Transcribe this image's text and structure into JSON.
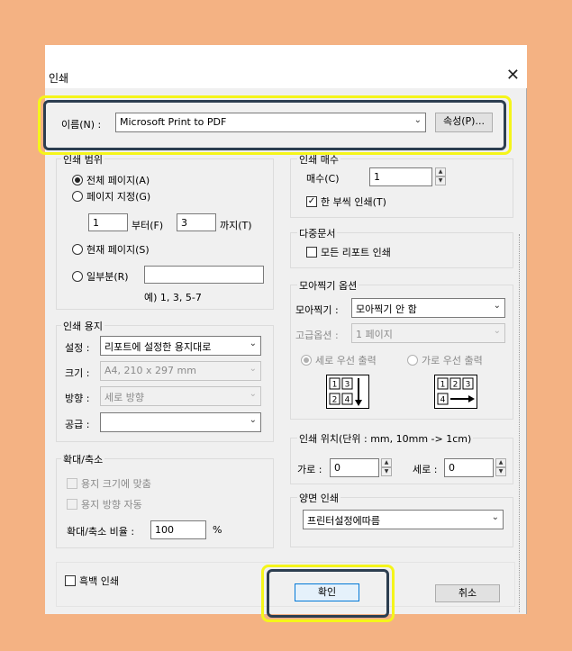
{
  "dialog": {
    "title": "인쇄",
    "close_glyph": "✕"
  },
  "printer": {
    "name_label": "이름(N) :",
    "selected": "Microsoft Print to PDF",
    "properties_button": "속성(P)..."
  },
  "range": {
    "group_label": "인쇄 범위",
    "all_pages": "전체 페이지(A)",
    "page_select": "페이지 지정(G)",
    "from_value": "1",
    "from_label": "부터(F)",
    "to_value": "3",
    "to_label": "까지(T)",
    "current_page": "현재 페이지(S)",
    "partial": "일부분(R)",
    "partial_value": "",
    "example": "예) 1, 3, 5-7"
  },
  "copies": {
    "group_label": "인쇄 매수",
    "count_label": "매수(C)",
    "count_value": "1",
    "collate": "한 부씩 인쇄(T)"
  },
  "multi_doc": {
    "group_label": "다중문서",
    "all_reports": "모든 리포트 인쇄"
  },
  "nup": {
    "group_label": "모아찍기 옵션",
    "mode_label": "모아찍기 :",
    "mode_value": "모아찍기 안 함",
    "advanced_label": "고급옵션 :",
    "advanced_value": "1 페이지",
    "vertical_first": "세로 우선 출력",
    "horizontal_first": "가로 우선 출력",
    "cells": [
      "1",
      "2",
      "3",
      "4"
    ]
  },
  "paper": {
    "group_label": "인쇄 용지",
    "setting_label": "설정 :",
    "setting_value": "리포트에 설정한 용지대로",
    "size_label": "크기 :",
    "size_value": "A4, 210 x 297 mm",
    "orientation_label": "방향 :",
    "orientation_value": "세로 방향",
    "feed_label": "공급 :",
    "feed_value": ""
  },
  "scale": {
    "group_label": "확대/축소",
    "fit_paper": "용지 크기에 맞춤",
    "auto_orient": "용지 방향 자동",
    "ratio_label": "확대/축소 비율 :",
    "ratio_value": "100",
    "ratio_unit": "%"
  },
  "position": {
    "group_label": "인쇄 위치(단위 : mm, 10mm -> 1cm)",
    "horizontal_label": "가로 :",
    "horizontal_value": "0",
    "vertical_label": "세로 :",
    "vertical_value": "0"
  },
  "duplex": {
    "group_label": "양면 인쇄",
    "value": "프린터설정에따름"
  },
  "bottom": {
    "grayscale": "흑백 인쇄",
    "ok": "확인",
    "cancel": "취소"
  },
  "colors": {
    "highlight_outer": "#f5f51a",
    "highlight_inner": "#2c3e50",
    "background": "#f4b283"
  }
}
